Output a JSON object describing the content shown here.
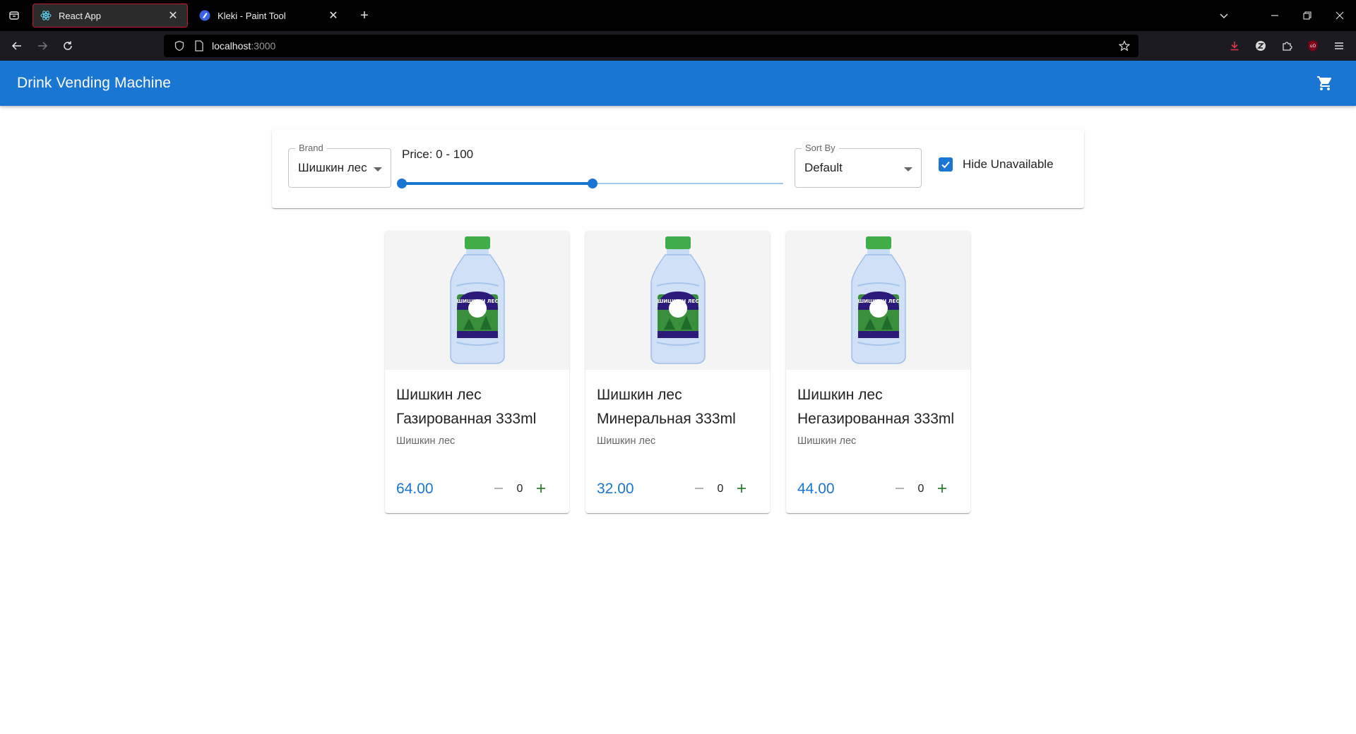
{
  "browser": {
    "tabs": [
      {
        "title": "React App",
        "active": true
      },
      {
        "title": "Kleki - Paint Tool",
        "active": false
      }
    ],
    "url": {
      "host": "localhost",
      "port": ":3000"
    }
  },
  "app": {
    "title": "Drink Vending Machine"
  },
  "filters": {
    "brand_label": "Brand",
    "brand_value": "Шишкин лес",
    "price_label": "Price: 0 - 100",
    "price_range": {
      "min": 0,
      "max": 100,
      "slider_min": 0,
      "slider_max": 200
    },
    "sort_label": "Sort By",
    "sort_value": "Default",
    "hide_unavailable_label": "Hide Unavailable",
    "hide_unavailable_checked": true
  },
  "products": [
    {
      "name": "Шишкин лес Газированная 333ml",
      "brand": "Шишкин лес",
      "price": "64.00",
      "qty": "0"
    },
    {
      "name": "Шишкин лес Минеральная 333ml",
      "brand": "Шишкин лес",
      "price": "32.00",
      "qty": "0"
    },
    {
      "name": "Шишкин лес Негазированная 333ml",
      "brand": "Шишкин лес",
      "price": "44.00",
      "qty": "0"
    }
  ],
  "colors": {
    "primary": "#1976d2",
    "plus": "#2e7d32",
    "minus": "#9e9e9e"
  },
  "icons": [
    "tab-list-icon",
    "react-icon",
    "kleki-icon",
    "close-icon",
    "plus-icon",
    "chevron-down-icon",
    "minimize-icon",
    "restore-icon",
    "back-icon",
    "forward-icon",
    "reload-icon",
    "shield-icon",
    "page-icon",
    "star-icon",
    "download-icon",
    "zotero-icon",
    "extensions-icon",
    "ublock-icon",
    "menu-icon",
    "cart-icon",
    "checkbox-icon",
    "minus-icon"
  ]
}
